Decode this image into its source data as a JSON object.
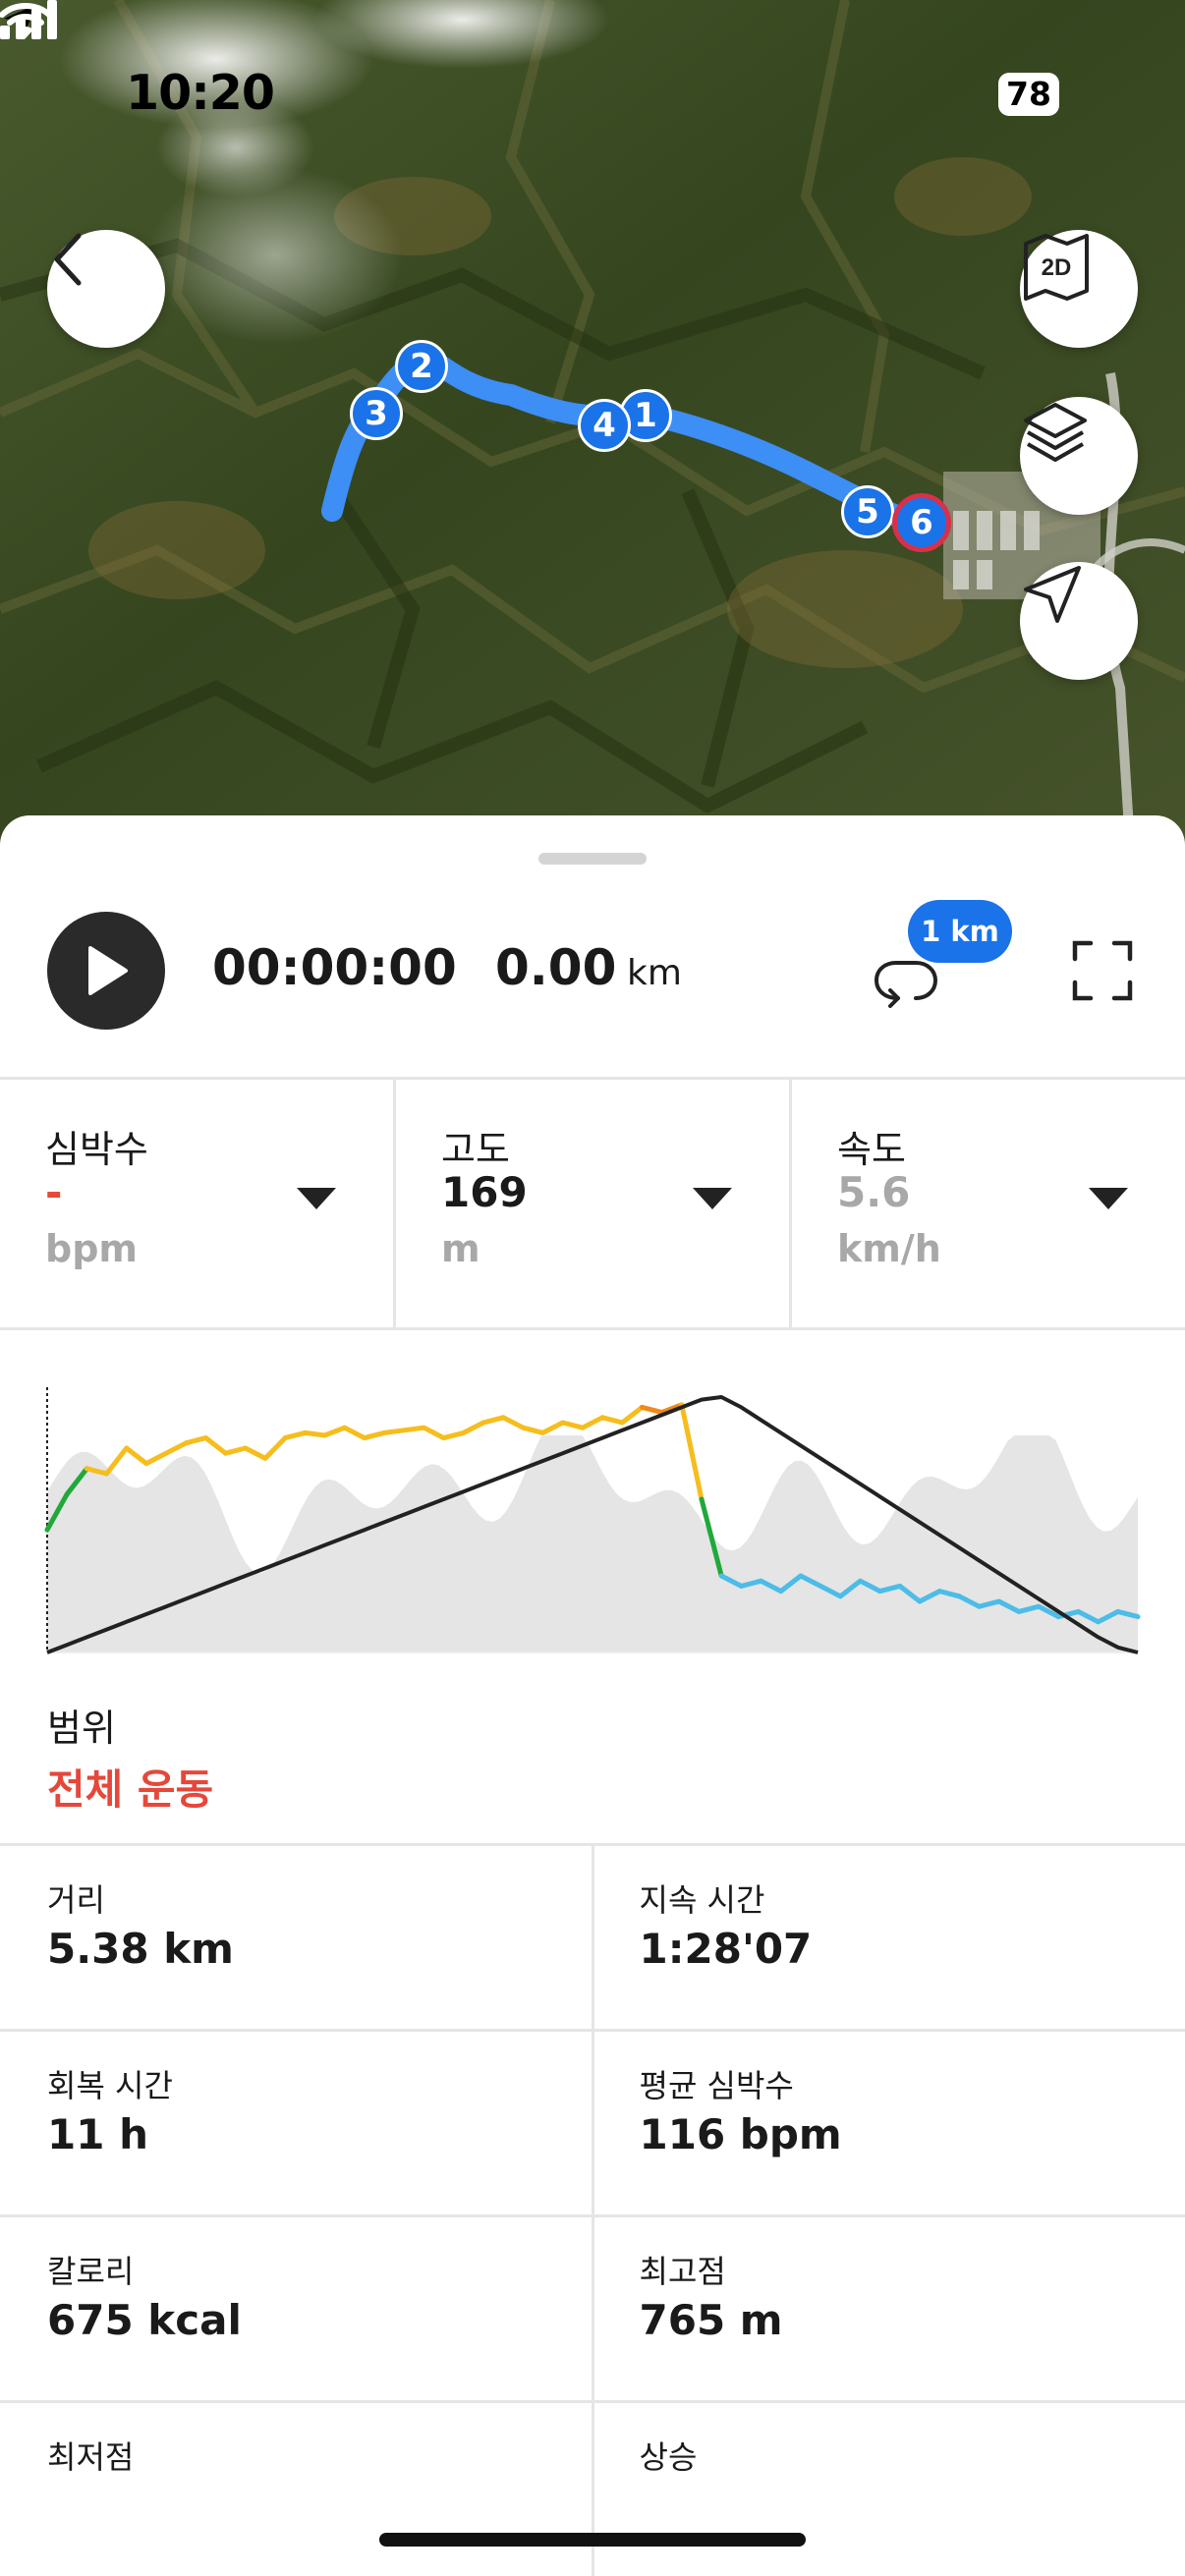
{
  "status_bar": {
    "time": "10:20",
    "battery": "78",
    "icons": [
      "location-arrow-icon",
      "cellular-signal-icon",
      "wifi-icon",
      "battery-icon"
    ]
  },
  "map": {
    "buttons": [
      "back-chevron-icon",
      "2d-map-icon",
      "layers-icon",
      "navigate-icon"
    ],
    "map_mode_label": "2D",
    "markers": [
      "1",
      "2",
      "3",
      "4",
      "5",
      "6"
    ],
    "route_color": "#3d8ef5",
    "end_marker_ring": "#d9304a"
  },
  "playback": {
    "elapsed": "00:00:00",
    "distance": "0.00",
    "distance_unit": "km",
    "lap_badge": "1 km"
  },
  "metrics": [
    {
      "label": "심박수",
      "value": "-",
      "unit": "bpm",
      "value_color": "#e5483a"
    },
    {
      "label": "고도",
      "value": "169",
      "unit": "m",
      "value_color": "#1a1a1a"
    },
    {
      "label": "속도",
      "value": "5.6",
      "unit": "km/h",
      "value_color": "#a8a8a8"
    }
  ],
  "chart_data": {
    "type": "line",
    "series": [
      {
        "color": "#222222",
        "values": [
          0,
          3,
          6,
          9,
          12,
          15,
          18,
          21,
          24,
          27,
          30,
          33,
          36,
          39,
          42,
          45,
          48,
          51,
          54,
          57,
          60,
          63,
          66,
          69,
          72,
          75,
          78,
          81,
          84,
          87,
          90,
          93,
          96,
          99,
          100,
          96,
          91,
          86,
          81,
          76,
          71,
          66,
          61,
          56,
          51,
          46,
          41,
          36,
          31,
          26,
          21,
          16,
          11,
          6,
          2,
          0
        ]
      },
      {
        "color_zones": [
          "#4cbce8",
          "#21a83a",
          "#f6bd1c",
          "#ef8a1a"
        ],
        "values": [
          48,
          62,
          72,
          70,
          80,
          74,
          78,
          82,
          84,
          78,
          80,
          76,
          84,
          86,
          85,
          88,
          84,
          86,
          87,
          88,
          84,
          86,
          90,
          92,
          88,
          86,
          90,
          88,
          92,
          90,
          96,
          94,
          97,
          60,
          30,
          26,
          28,
          24,
          30,
          26,
          22,
          28,
          24,
          26,
          20,
          24,
          22,
          18,
          20,
          16,
          18,
          14,
          16,
          12,
          16,
          14
        ]
      }
    ],
    "background_area": {
      "color": "#e5e5e5",
      "description_note": ""
    }
  },
  "range": {
    "label": "범위",
    "value": "전체 운동"
  },
  "stats": [
    [
      {
        "label": "거리",
        "value": "5.38 km"
      },
      {
        "label": "지속 시간",
        "value": "1:28'07"
      }
    ],
    [
      {
        "label": "회복 시간",
        "value": "11 h"
      },
      {
        "label": "평균 심박수",
        "value": "116 bpm"
      }
    ],
    [
      {
        "label": "칼로리",
        "value": "675 kcal"
      },
      {
        "label": "최고점",
        "value": "765 m"
      }
    ],
    [
      {
        "label": "최저점",
        "value": ""
      },
      {
        "label": "상승",
        "value": ""
      }
    ]
  ]
}
